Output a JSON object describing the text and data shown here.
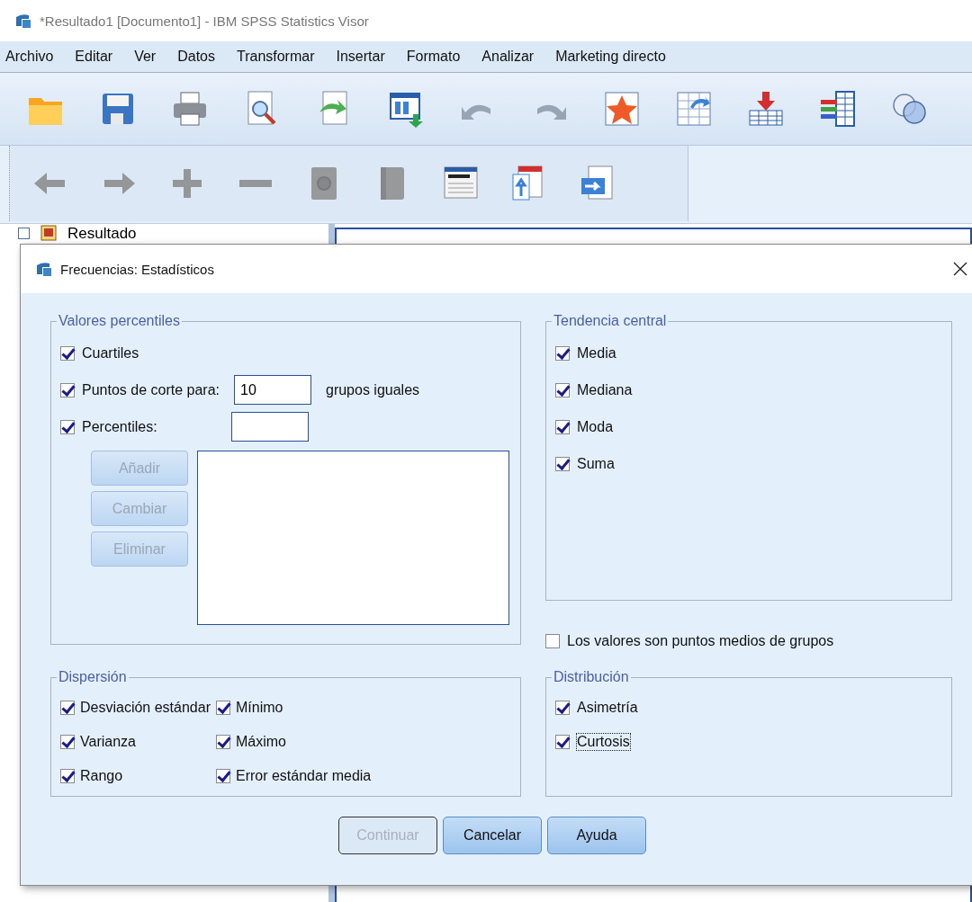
{
  "window": {
    "title": "*Resultado1 [Documento1] - IBM SPSS Statistics Visor"
  },
  "menu": [
    "Archivo",
    "Editar",
    "Ver",
    "Datos",
    "Transformar",
    "Insertar",
    "Formato",
    "Analizar",
    "Marketing directo"
  ],
  "toolbar": [
    {
      "kind": "open",
      "disabled": false
    },
    {
      "kind": "save",
      "disabled": false
    },
    {
      "kind": "print",
      "disabled": false
    },
    {
      "kind": "preview",
      "disabled": false
    },
    {
      "kind": "export",
      "disabled": false
    },
    {
      "kind": "data",
      "disabled": false
    },
    {
      "kind": "undo",
      "disabled": true
    },
    {
      "kind": "redo",
      "disabled": true
    },
    {
      "kind": "star",
      "disabled": false
    },
    {
      "kind": "table",
      "disabled": false
    },
    {
      "kind": "insert",
      "disabled": false
    },
    {
      "kind": "variables",
      "disabled": false
    },
    {
      "kind": "venn",
      "disabled": false
    }
  ],
  "toolbar_2": [
    {
      "kind": "back",
      "disabled": true
    },
    {
      "kind": "forward",
      "disabled": true
    },
    {
      "kind": "expand",
      "disabled": true
    },
    {
      "kind": "collapse",
      "disabled": true
    },
    {
      "kind": "show",
      "disabled": true
    },
    {
      "kind": "hide",
      "disabled": true
    },
    {
      "kind": "heading",
      "disabled": false
    },
    {
      "kind": "title",
      "disabled": false
    },
    {
      "kind": "text",
      "disabled": false
    }
  ],
  "outline": {
    "label": "Resultado"
  },
  "dialog": {
    "title": "Frecuencias: Estadísticos",
    "percentiles": {
      "title": "Valores percentiles",
      "options": [
        {
          "kind": "plain",
          "label": "Cuartiles",
          "checked": true
        },
        {
          "kind": "cut_points",
          "label": "Puntos de corte para:",
          "checked": true,
          "value": "10",
          "suffix": "grupos iguales"
        },
        {
          "kind": "percentiles",
          "label": "Percentiles:",
          "checked": true
        }
      ],
      "buttons": [
        {
          "label": "Añadir",
          "disabled": true
        },
        {
          "label": "Cambiar",
          "disabled": true
        },
        {
          "label": "Eliminar",
          "disabled": true
        }
      ]
    },
    "central_tendency": {
      "title": "Tendencia central",
      "options": [
        {
          "label": "Media",
          "checked": true
        },
        {
          "label": "Mediana",
          "checked": true
        },
        {
          "label": "Moda",
          "checked": true
        },
        {
          "label": "Suma",
          "checked": true
        }
      ]
    },
    "midpoints": {
      "label": "Los valores son puntos medios de grupos",
      "checked": false
    },
    "dispersion": {
      "title": "Dispersión",
      "options": [
        {
          "label": "Desviación estándar",
          "checked": true
        },
        {
          "label": "Mínimo",
          "checked": true
        },
        {
          "label": "Varianza",
          "checked": true
        },
        {
          "label": "Máximo",
          "checked": true
        },
        {
          "label": "Rango",
          "checked": true
        },
        {
          "label": "Error estándar media",
          "checked": true
        }
      ]
    },
    "distribution": {
      "title": "Distribución",
      "options": [
        {
          "label": "Asimetría",
          "checked": true,
          "focused": false
        },
        {
          "label": "Curtosis",
          "checked": true,
          "focused": true
        }
      ]
    },
    "buttons": [
      {
        "label": "Continuar",
        "disabled": true
      },
      {
        "label": "Cancelar",
        "disabled": false
      },
      {
        "label": "Ayuda",
        "disabled": false
      }
    ]
  }
}
